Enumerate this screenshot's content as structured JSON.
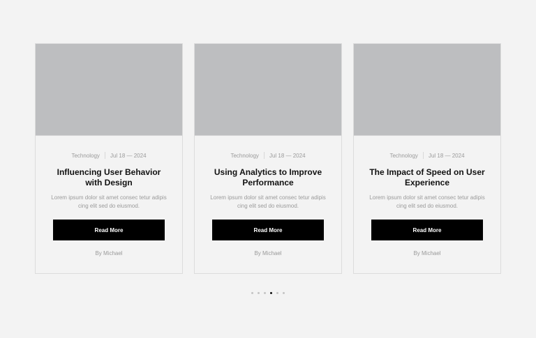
{
  "cards": [
    {
      "category": "Technology",
      "date": "Jul 18 — 2024",
      "title": "Influencing User Behavior with Design",
      "excerpt": "Lorem ipsum dolor sit amet consec tetur adipis cing elit sed do eiusmod.",
      "button_label": "Read More",
      "author": "By Michael"
    },
    {
      "category": "Technology",
      "date": "Jul 18 — 2024",
      "title": "Using Analytics to Improve Performance",
      "excerpt": "Lorem ipsum dolor sit amet consec tetur adipis cing elit sed do eiusmod.",
      "button_label": "Read More",
      "author": "By Michael"
    },
    {
      "category": "Technology",
      "date": "Jul 18 — 2024",
      "title": "The Impact of Speed on User Experience",
      "excerpt": "Lorem ipsum dolor sit amet consec tetur adipis cing elit sed do eiusmod.",
      "button_label": "Read More",
      "author": "By Michael"
    }
  ],
  "pagination": {
    "total": 6,
    "active_index": 3
  },
  "colors": {
    "background": "#f3f3f3",
    "image_placeholder": "#bdbec0",
    "button": "#000000",
    "active_dot": "#111111"
  }
}
